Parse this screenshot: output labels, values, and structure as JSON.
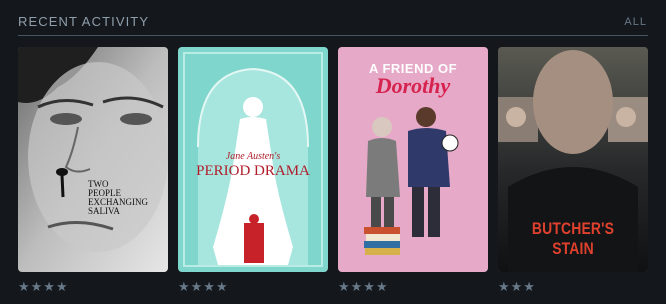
{
  "section": {
    "title": "Recent Activity",
    "all_link": "ALL"
  },
  "films": [
    {
      "title_line1": "TWO",
      "title_line2": "PEOPLE",
      "title_line3": "EXCHANGING",
      "title_line4": "SALIVA",
      "rating": "★★★★"
    },
    {
      "title_script": "Jane Austen's",
      "title_main": "PERIOD DRAMA",
      "rating": "★★★★"
    },
    {
      "title_line1": "A FRIEND OF",
      "title_script": "Dorothy",
      "rating": "★★★★"
    },
    {
      "title_main": "BUTCHER'S STAIN",
      "rating": "★★★"
    }
  ],
  "colors": {
    "background": "#14181c",
    "header_text": "#8f9eab",
    "rating_stars": "#677888"
  }
}
